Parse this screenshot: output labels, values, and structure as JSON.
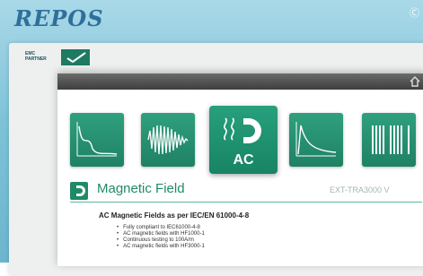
{
  "brand": {
    "logo_text": "REPOS",
    "corner_mark": "Ⓒ"
  },
  "emc_badge": {
    "line1": "EMC",
    "line2": "PARTNER"
  },
  "toolbar": {
    "home_icon": "home-icon"
  },
  "tiles": [
    {
      "name": "decay-curve",
      "icon": "waveform-icon"
    },
    {
      "name": "burst",
      "icon": "waveform-icon"
    },
    {
      "name": "ac-magnetic",
      "icon": "magnet-icon",
      "label": "AC",
      "selected": true
    },
    {
      "name": "pulse",
      "icon": "waveform-icon"
    },
    {
      "name": "bars",
      "icon": "waveform-icon"
    }
  ],
  "section": {
    "title": "Magnetic Field",
    "model": "EXT-TRA3000 V",
    "heading": "AC Magnetic Fields as per IEC/EN 61000-4-8",
    "features": [
      "Fully compliant to IEC61000-4-8",
      "AC magnetic fields with HF1000-1",
      "Continuous testing to 100A/m",
      "AC magnetic fields with HF3000-1"
    ]
  },
  "colors": {
    "accent": "#1f8a68",
    "frame": "#7fc3d8",
    "logo": "#2f6f9b"
  }
}
